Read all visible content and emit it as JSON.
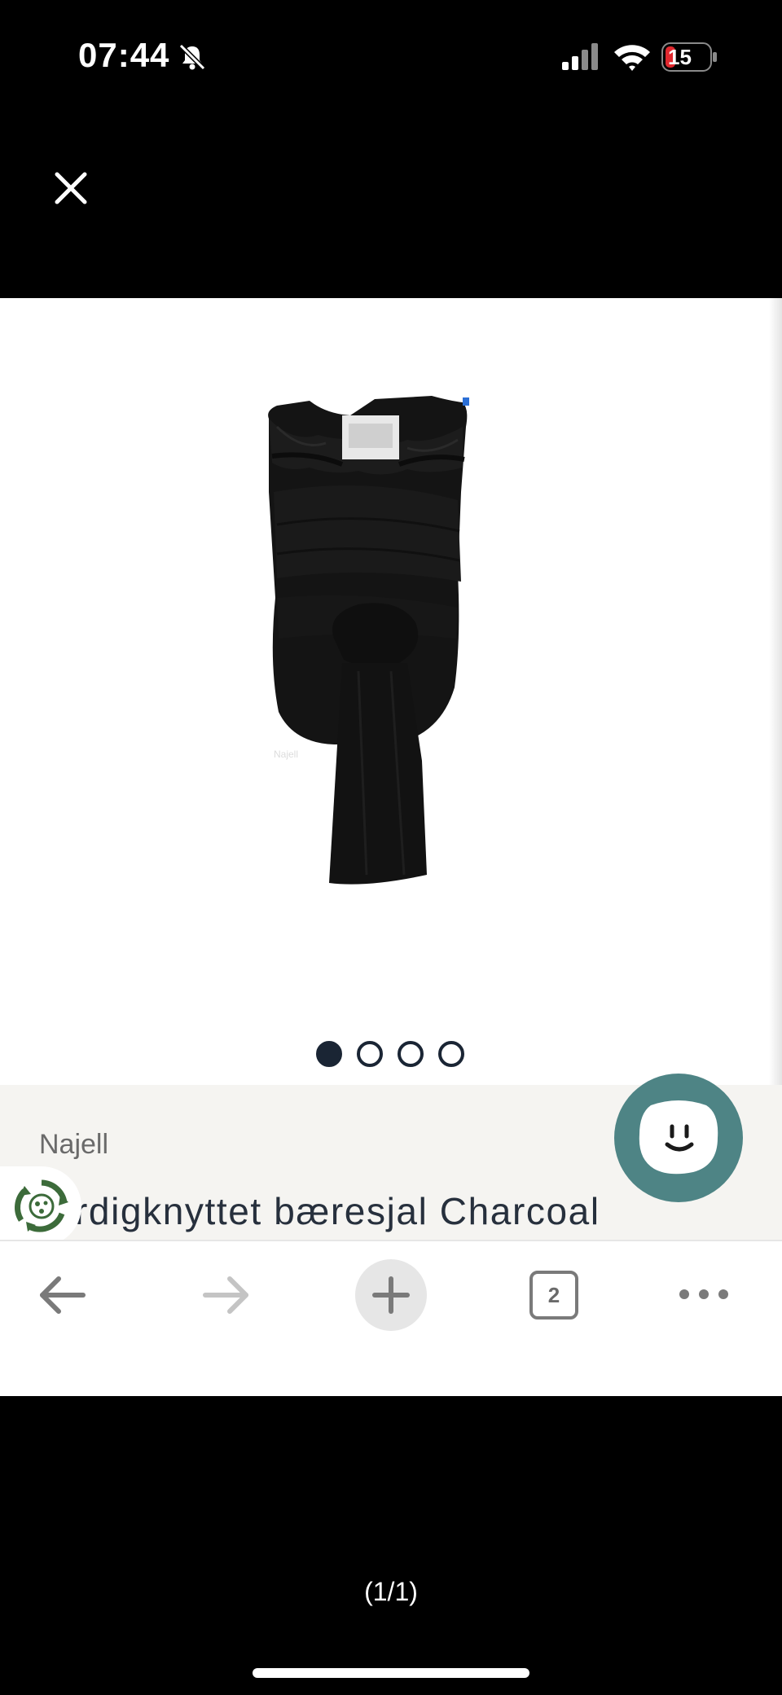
{
  "status_bar": {
    "time": "07:44",
    "battery": "15"
  },
  "viewer": {
    "close_icon": "close-icon",
    "counter": "(1/1)"
  },
  "product": {
    "image_icon": "baby-carrier-wrap-image",
    "carousel_total": 4,
    "carousel_active": 1,
    "brand": "Najell",
    "title": "rdigknyttet bæresjal Charcoal"
  },
  "chat": {
    "icon": "chat-face-icon"
  },
  "eco_badge": {
    "icon": "recycle-leaf-icon"
  },
  "toolbar": {
    "tab_count": "2",
    "back_icon": "arrow-left-icon",
    "forward_icon": "arrow-right-icon",
    "new_tab_icon": "plus-icon",
    "more_icon": "more-dots-icon"
  },
  "colors": {
    "panel_background": "#f5f4f1",
    "chat_accent": "#4e8485",
    "title_text": "#27303d",
    "dot_active": "#1a2534"
  }
}
